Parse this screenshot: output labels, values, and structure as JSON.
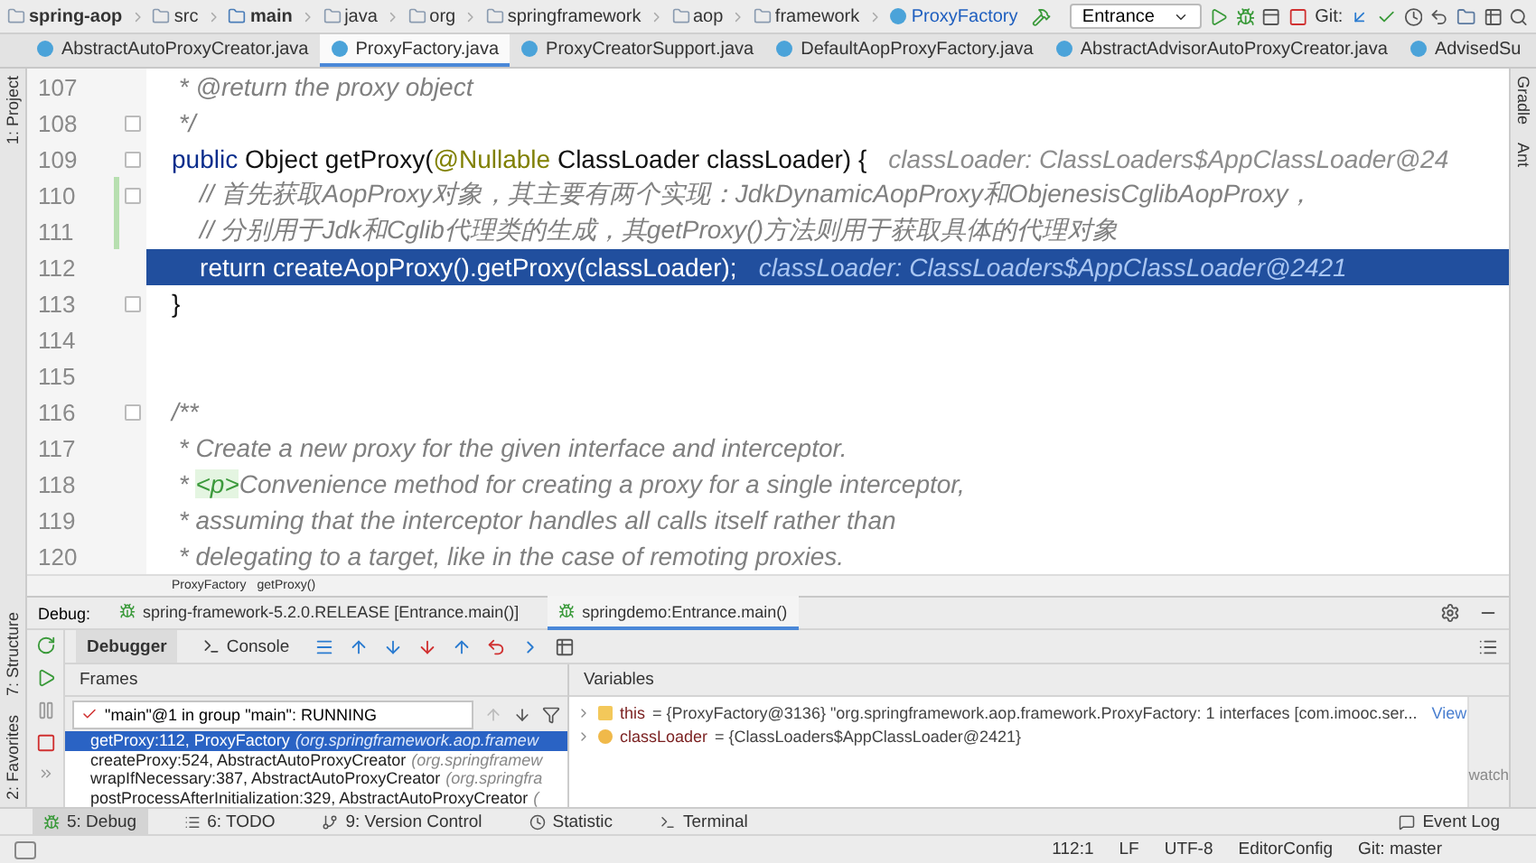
{
  "nav_bar": {
    "breadcrumbs": [
      {
        "kind": "project",
        "label": "spring-aop"
      },
      {
        "kind": "folder",
        "label": "src"
      },
      {
        "kind": "module",
        "label": "main"
      },
      {
        "kind": "folder",
        "label": "java"
      },
      {
        "kind": "folder",
        "label": "org"
      },
      {
        "kind": "folder",
        "label": "springframework"
      },
      {
        "kind": "folder",
        "label": "aop"
      },
      {
        "kind": "folder",
        "label": "framework"
      },
      {
        "kind": "class",
        "label": "ProxyFactory"
      }
    ],
    "run_config": "Entrance",
    "git_label": "Git:"
  },
  "editor_tabs": [
    {
      "label": "AbstractAutoProxyCreator.java",
      "selected": false
    },
    {
      "label": "ProxyFactory.java",
      "selected": true
    },
    {
      "label": "ProxyCreatorSupport.java",
      "selected": false
    },
    {
      "label": "DefaultAopProxyFactory.java",
      "selected": false
    },
    {
      "label": "AbstractAdvisorAutoProxyCreator.java",
      "selected": false
    },
    {
      "label": "AdvisedSu",
      "selected": false
    }
  ],
  "left_stripe": {
    "top": [
      "1: Project"
    ],
    "bottom": [
      "7: Structure",
      "2: Favorites"
    ]
  },
  "right_stripe": [
    "Gradle",
    "Ant"
  ],
  "code_lines": [
    {
      "number": "107",
      "current": false,
      "fold": false,
      "changed": false,
      "segments": [
        {
          "kind": "comment",
          "text": " * @return the proxy object"
        }
      ]
    },
    {
      "number": "108",
      "current": false,
      "fold": true,
      "changed": false,
      "segments": [
        {
          "kind": "comment",
          "text": " */"
        }
      ]
    },
    {
      "number": "109",
      "current": false,
      "fold": true,
      "changed": false,
      "segments": [
        {
          "kind": "keyword",
          "text": "public"
        },
        {
          "kind": "plain",
          "text": " Object getProxy("
        },
        {
          "kind": "annotation",
          "text": "@Nullable"
        },
        {
          "kind": "plain",
          "text": " ClassLoader classLoader) {"
        },
        {
          "kind": "hint",
          "text": "classLoader: ClassLoaders$AppClassLoader@24"
        }
      ]
    },
    {
      "number": "110",
      "current": false,
      "fold": true,
      "changed": true,
      "segments": [
        {
          "kind": "comment",
          "text": "    // 首先获取AopProxy对象，其主要有两个实现：JdkDynamicAopProxy和ObjenesisCglibAopProxy，"
        }
      ]
    },
    {
      "number": "111",
      "current": false,
      "fold": false,
      "changed": true,
      "segments": [
        {
          "kind": "comment",
          "text": "    // 分别用于Jdk和Cglib代理类的生成，其getProxy()方法则用于获取具体的代理对象"
        }
      ]
    },
    {
      "number": "112",
      "current": true,
      "fold": false,
      "changed": false,
      "segments": [
        {
          "kind": "keyword",
          "text": "    return"
        },
        {
          "kind": "plain",
          "text": " createAopProxy().getProxy(classLoader);"
        },
        {
          "kind": "hint",
          "text": "classLoader: ClassLoaders$AppClassLoader@2421"
        }
      ]
    },
    {
      "number": "113",
      "current": false,
      "fold": true,
      "changed": false,
      "segments": [
        {
          "kind": "plain",
          "text": "}"
        }
      ]
    },
    {
      "number": "114",
      "current": false,
      "fold": false,
      "changed": false
    },
    {
      "number": "115",
      "current": false,
      "fold": false,
      "changed": false
    },
    {
      "number": "116",
      "current": false,
      "fold": true,
      "changed": false,
      "segments": [
        {
          "kind": "comment",
          "text": "/**"
        }
      ]
    },
    {
      "number": "117",
      "current": false,
      "fold": false,
      "changed": false,
      "segments": [
        {
          "kind": "comment",
          "text": " * Create a new proxy for the given interface and interceptor."
        }
      ]
    },
    {
      "number": "118",
      "current": false,
      "fold": false,
      "changed": false,
      "segments": [
        {
          "kind": "comment",
          "text": " * "
        },
        {
          "kind": "tag",
          "text": "<p>"
        },
        {
          "kind": "comment",
          "text": "Convenience method for creating a proxy for a single interceptor,"
        }
      ]
    },
    {
      "number": "119",
      "current": false,
      "fold": false,
      "changed": false,
      "segments": [
        {
          "kind": "comment",
          "text": " * assuming that the interceptor handles all calls itself rather than"
        }
      ]
    },
    {
      "number": "120",
      "current": false,
      "fold": false,
      "changed": false,
      "segments": [
        {
          "kind": "comment",
          "text": " * delegating to a target, like in the case of remoting proxies."
        }
      ]
    }
  ],
  "editor_breadcrumbs": [
    "ProxyFactory",
    "getProxy()"
  ],
  "debug": {
    "label": "Debug:",
    "sessions": [
      {
        "label": "spring-framework-5.2.0.RELEASE [Entrance.main()]",
        "selected": false
      },
      {
        "label": "springdemo:Entrance.main()",
        "selected": true
      }
    ],
    "tabs": [
      {
        "label": "Debugger",
        "selected": true
      },
      {
        "label": "Console",
        "selected": false
      }
    ],
    "frames_title": "Frames",
    "thread": "\"main\"@1 in group \"main\": RUNNING",
    "frames": [
      {
        "method": "getProxy:112, ProxyFactory",
        "location": "(org.springframework.aop.framew",
        "selected": true
      },
      {
        "method": "createProxy:524, AbstractAutoProxyCreator",
        "location": "(org.springframew",
        "selected": false
      },
      {
        "method": "wrapIfNecessary:387, AbstractAutoProxyCreator",
        "location": "(org.springfra",
        "selected": false
      },
      {
        "method": "postProcessAfterInitialization:329, AbstractAutoProxyCreator",
        "location": "(",
        "selected": false
      }
    ],
    "variables_title": "Variables",
    "variables": [
      {
        "kind": "field",
        "name": "this",
        "value": "= {ProxyFactory@3136} \"org.springframework.aop.framework.ProxyFactory: 1 interfaces [com.imooc.ser...",
        "link": "View"
      },
      {
        "kind": "param",
        "name": "classLoader",
        "value": "= {ClassLoaders$AppClassLoader@2421}"
      }
    ],
    "watch_hint": "watch"
  },
  "tool_windows": [
    {
      "label": "5: Debug",
      "selected": true
    },
    {
      "label": "6: TODO",
      "selected": false
    },
    {
      "label": "9: Version Control",
      "selected": false
    },
    {
      "label": "Statistic",
      "selected": false
    },
    {
      "label": "Terminal",
      "selected": false
    }
  ],
  "event_log": "Event Log",
  "status_bar": [
    "112:1",
    "LF",
    "UTF-8",
    "EditorConfig",
    "Git: master"
  ]
}
